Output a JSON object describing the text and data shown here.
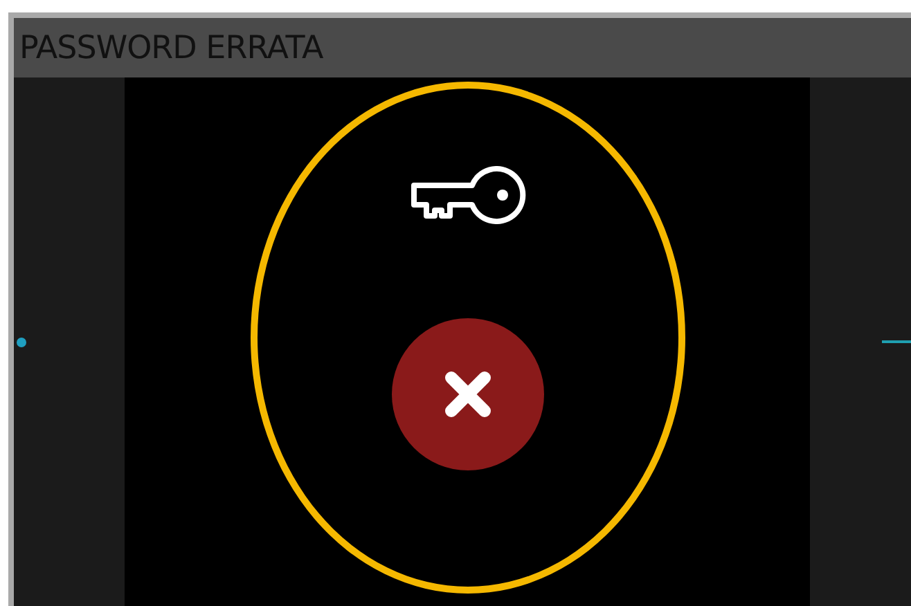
{
  "window": {
    "title": "PASSWORD ERRATA"
  },
  "status": {
    "kind": "error"
  }
}
